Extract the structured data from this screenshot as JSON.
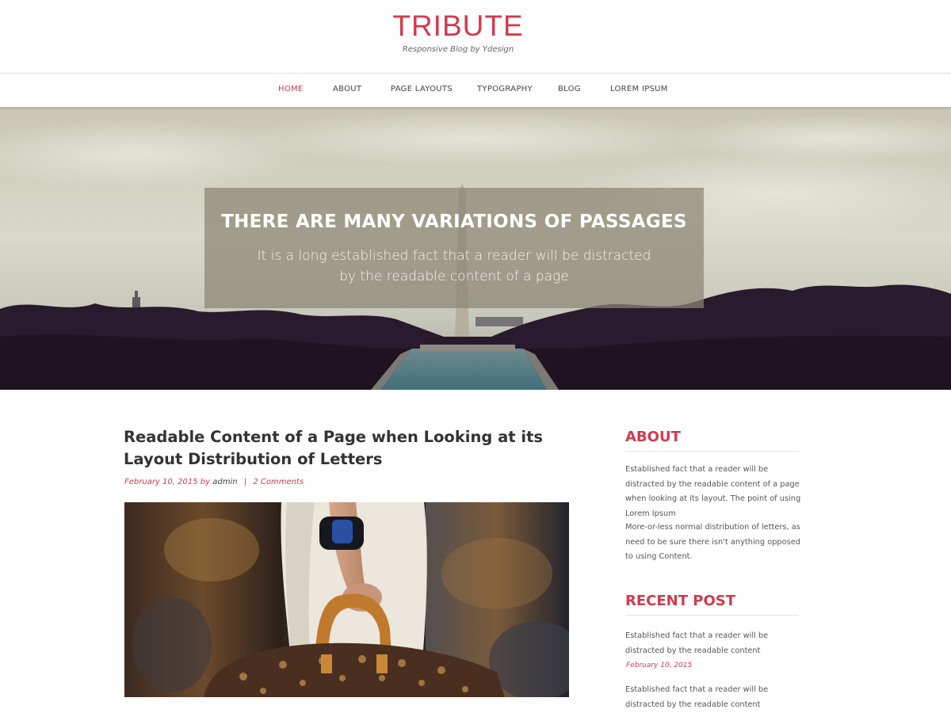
{
  "header": {
    "site_title": "TRIBUTE",
    "tagline": "Responsive Blog by Ydesign"
  },
  "nav": {
    "items": [
      {
        "label": "HOME",
        "active": true
      },
      {
        "label": "ABOUT",
        "active": false
      },
      {
        "label": "PAGE LAYOUTS",
        "active": false
      },
      {
        "label": "TYPOGRAPHY",
        "active": false
      },
      {
        "label": "BLOG",
        "active": false
      },
      {
        "label": "LOREM IPSUM",
        "active": false
      }
    ]
  },
  "hero": {
    "heading": "THERE ARE MANY VARIATIONS OF PASSAGES",
    "subtitle": "It is a long established fact that a reader will be distracted by the readable content of a page"
  },
  "post": {
    "title": "Readable Content of a Page when Looking at its Layout Distribution of Letters",
    "date": "February 10, 2015",
    "by": "by",
    "author": "admin",
    "separator": "|",
    "comments": "2 Comments"
  },
  "sidebar": {
    "about": {
      "title": "ABOUT",
      "paragraphs": [
        "Established fact that a reader will be distracted by the readable content of a page when looking at its layout. The point of using Lorem Ipsum",
        "More-or-less normal distribution of letters, as need to be sure there isn't anything opposed to using Content."
      ]
    },
    "recent": {
      "title": "RECENT POST",
      "items": [
        {
          "text": "Established fact that a reader will be distracted by the readable content",
          "date": "February 10, 2015"
        },
        {
          "text": "Established fact that a reader will be distracted by the readable content",
          "date": ""
        }
      ]
    }
  },
  "colors": {
    "accent": "#d33a4d",
    "text": "#333333",
    "muted": "#555555"
  }
}
